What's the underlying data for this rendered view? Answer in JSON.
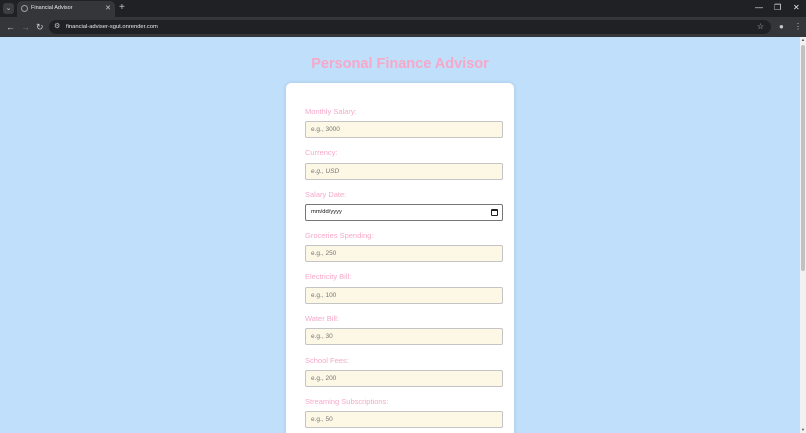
{
  "browser": {
    "tab_title": "Financial Advisor",
    "url": "financial-adviser-sgut.onrender.com",
    "icons": [
      "tab-search-icon",
      "close-icon",
      "new-tab-icon",
      "minimize-icon",
      "restore-icon",
      "back-icon",
      "forward-icon",
      "reload-icon",
      "site-info-icon",
      "bookmark-star-icon",
      "profile-icon",
      "menu-icon"
    ]
  },
  "page": {
    "title": "Personal Finance Advisor"
  },
  "form": {
    "fields": [
      {
        "label": "Monthly Salary:",
        "placeholder": "e.g., 3000"
      },
      {
        "label": "Currency:",
        "placeholder": "e.g., USD"
      },
      {
        "label": "Salary Date:",
        "value": "mm/dd/yyyy"
      },
      {
        "label": "Groceries Spending:",
        "placeholder": "e.g., 250"
      },
      {
        "label": "Electricity Bill:",
        "placeholder": "e.g., 100"
      },
      {
        "label": "Water Bill:",
        "placeholder": "e.g., 30"
      },
      {
        "label": "School Fees:",
        "placeholder": "e.g., 200"
      },
      {
        "label": "Streaming Subscriptions:",
        "placeholder": "e.g., 50"
      }
    ]
  },
  "colors": {
    "page_background": "#bfdffb",
    "accent_pink": "#f7a8c8",
    "input_background": "#fdf8e6"
  }
}
